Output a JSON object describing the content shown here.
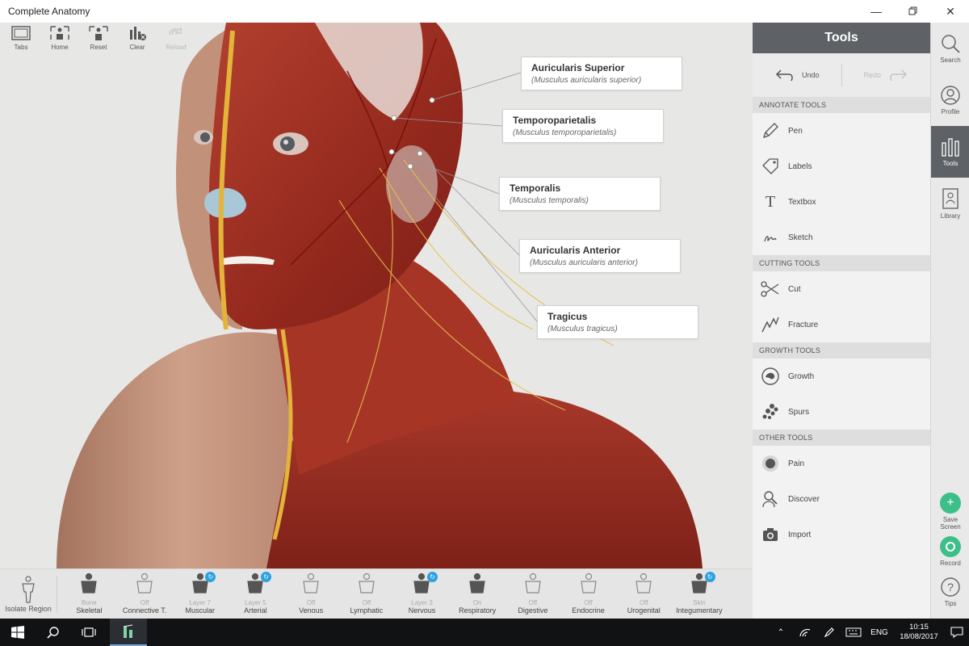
{
  "window": {
    "title": "Complete Anatomy"
  },
  "top_toolbar": [
    {
      "label": "Tabs",
      "icon": "tabs-icon",
      "enabled": true
    },
    {
      "label": "Home",
      "icon": "home-icon",
      "enabled": true
    },
    {
      "label": "Reset",
      "icon": "reset-icon",
      "enabled": true
    },
    {
      "label": "Clear",
      "icon": "clear-icon",
      "enabled": true
    },
    {
      "label": "Reload",
      "icon": "reload-icon",
      "enabled": false
    }
  ],
  "labels": [
    {
      "name": "Auricularis Superior",
      "latin": "(Musculus auricularis superior)"
    },
    {
      "name": "Temporoparietalis",
      "latin": "(Musculus temporoparietalis)"
    },
    {
      "name": "Temporalis",
      "latin": "(Musculus temporalis)"
    },
    {
      "name": "Auricularis Anterior",
      "latin": "(Musculus auricularis anterior)"
    },
    {
      "name": "Tragicus",
      "latin": "(Musculus tragicus)"
    }
  ],
  "tools_panel": {
    "title": "Tools",
    "undo": "Undo",
    "redo": "Redo",
    "sections": [
      {
        "title": "ANNOTATE TOOLS",
        "items": [
          {
            "label": "Pen",
            "icon": "pen-icon"
          },
          {
            "label": "Labels",
            "icon": "label-tag-icon"
          },
          {
            "label": "Textbox",
            "icon": "textbox-icon"
          },
          {
            "label": "Sketch",
            "icon": "sketch-icon"
          }
        ]
      },
      {
        "title": "CUTTING TOOLS",
        "items": [
          {
            "label": "Cut",
            "icon": "scissors-icon"
          },
          {
            "label": "Fracture",
            "icon": "fracture-icon"
          }
        ]
      },
      {
        "title": "GROWTH TOOLS",
        "items": [
          {
            "label": "Growth",
            "icon": "growth-icon"
          },
          {
            "label": "Spurs",
            "icon": "spurs-icon"
          }
        ]
      },
      {
        "title": "OTHER TOOLS",
        "items": [
          {
            "label": "Pain",
            "icon": "pain-icon"
          },
          {
            "label": "Discover",
            "icon": "discover-icon"
          },
          {
            "label": "Import",
            "icon": "camera-icon"
          }
        ]
      }
    ]
  },
  "right_strip": {
    "items": [
      {
        "label": "Search",
        "icon": "search-icon",
        "active": false
      },
      {
        "label": "Profile",
        "icon": "profile-icon",
        "active": false
      },
      {
        "label": "Tools",
        "icon": "tools-icon",
        "active": true
      },
      {
        "label": "Library",
        "icon": "library-icon",
        "active": false
      }
    ],
    "save_screen": "Save Screen",
    "record": "Record",
    "tips": "Tips"
  },
  "isolate": {
    "label": "Isolate Region"
  },
  "layers": [
    {
      "state": "Bone",
      "name": "Skeletal",
      "badge": false
    },
    {
      "state": "Off",
      "name": "Connective T.",
      "badge": false
    },
    {
      "state": "Layer 7",
      "name": "Muscular",
      "badge": true
    },
    {
      "state": "Layer 5",
      "name": "Arterial",
      "badge": true
    },
    {
      "state": "Off",
      "name": "Venous",
      "badge": false
    },
    {
      "state": "Off",
      "name": "Lymphatic",
      "badge": false
    },
    {
      "state": "Layer 3",
      "name": "Nervous",
      "badge": true
    },
    {
      "state": "On",
      "name": "Respiratory",
      "badge": false
    },
    {
      "state": "Off",
      "name": "Digestive",
      "badge": false
    },
    {
      "state": "Off",
      "name": "Endocrine",
      "badge": false
    },
    {
      "state": "Off",
      "name": "Urogenital",
      "badge": false
    },
    {
      "state": "Skin",
      "name": "Integumentary",
      "badge": true
    }
  ],
  "taskbar": {
    "language": "ENG",
    "time": "10:15",
    "date": "18/08/2017"
  },
  "colors": {
    "accent_green": "#3dbf8a",
    "header_grey": "#5e6166",
    "badge_blue": "#2da1e0",
    "muscle": "#9e2e22",
    "skin": "#c99a84"
  }
}
